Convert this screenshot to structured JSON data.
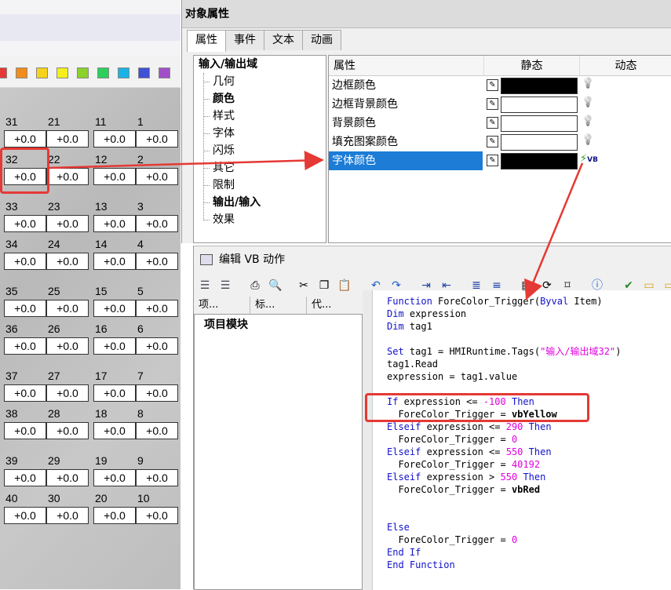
{
  "left_panel": {
    "palette_colors": [
      "#e53935",
      "#f28c1c",
      "#f7d21a",
      "#f5ef1b",
      "#8bd22a",
      "#2bcf5b",
      "#1ab3e6",
      "#3f51d4",
      "#a04fc8"
    ],
    "cells": [
      {
        "row": 0,
        "labels": [
          "31",
          "21",
          "11",
          "1"
        ],
        "values": [
          "+0.0",
          "+0.0",
          "+0.0",
          "+0.0"
        ]
      },
      {
        "row": 1,
        "labels": [
          "32",
          "22",
          "12",
          "2"
        ],
        "values": [
          "+0.0",
          "+0.0",
          "+0.0",
          "+0.0"
        ]
      },
      {
        "row": 2,
        "labels": [
          "33",
          "23",
          "13",
          "3"
        ],
        "values": [
          "+0.0",
          "+0.0",
          "+0.0",
          "+0.0"
        ]
      },
      {
        "row": 3,
        "labels": [
          "34",
          "24",
          "14",
          "4"
        ],
        "values": [
          "+0.0",
          "+0.0",
          "+0.0",
          "+0.0"
        ]
      },
      {
        "row": 4,
        "labels": [
          "35",
          "25",
          "15",
          "5"
        ],
        "values": [
          "+0.0",
          "+0.0",
          "+0.0",
          "+0.0"
        ]
      },
      {
        "row": 5,
        "labels": [
          "36",
          "26",
          "16",
          "6"
        ],
        "values": [
          "+0.0",
          "+0.0",
          "+0.0",
          "+0.0"
        ]
      },
      {
        "row": 6,
        "labels": [
          "37",
          "27",
          "17",
          "7"
        ],
        "values": [
          "+0.0",
          "+0.0",
          "+0.0",
          "+0.0"
        ]
      },
      {
        "row": 7,
        "labels": [
          "38",
          "28",
          "18",
          "8"
        ],
        "values": [
          "+0.0",
          "+0.0",
          "+0.0",
          "+0.0"
        ]
      },
      {
        "row": 8,
        "labels": [
          "39",
          "29",
          "19",
          "9"
        ],
        "values": [
          "+0.0",
          "+0.0",
          "+0.0",
          "+0.0"
        ]
      },
      {
        "row": 9,
        "labels": [
          "40",
          "30",
          "20",
          "10"
        ],
        "values": [
          "+0.0",
          "+0.0",
          "+0.0",
          "+0.0"
        ]
      }
    ]
  },
  "props": {
    "title": "对象属性",
    "tabs": [
      "属性",
      "事件",
      "文本",
      "动画"
    ],
    "tree": {
      "root": "输入/输出域",
      "items": [
        {
          "label": "几何",
          "bold": false
        },
        {
          "label": "颜色",
          "bold": true
        },
        {
          "label": "样式",
          "bold": false
        },
        {
          "label": "字体",
          "bold": false
        },
        {
          "label": "闪烁",
          "bold": false
        },
        {
          "label": "其它",
          "bold": false
        },
        {
          "label": "限制",
          "bold": false
        },
        {
          "label": "输出/输入",
          "bold": true
        },
        {
          "label": "效果",
          "bold": false
        }
      ]
    },
    "grid": {
      "headers": [
        "属性",
        "静态",
        "动态"
      ],
      "rows": [
        {
          "name": "边框颜色",
          "color": "#000000",
          "dynamic": "bulb-icon",
          "selected": false
        },
        {
          "name": "边框背景颜色",
          "color": "#ffffff",
          "dynamic": "bulb-icon",
          "selected": false
        },
        {
          "name": "背景颜色",
          "color": "#ffffff",
          "dynamic": "bulb-icon",
          "selected": false
        },
        {
          "name": "填充图案颜色",
          "color": "#ffffff",
          "dynamic": "bulb-icon",
          "selected": false
        },
        {
          "name": "字体颜色",
          "color": "#000000",
          "dynamic": "vb-script-icon",
          "selected": true
        }
      ],
      "vb_badge": "VB"
    }
  },
  "vb_editor": {
    "title": "编辑 VB 动作",
    "pane_tabs": [
      "项...",
      "标...",
      "代..."
    ],
    "tree_root": "项目模块",
    "code_lines": [
      [
        {
          "t": "Function",
          "c": "kw"
        },
        {
          "t": " ForeColor_Trigger(",
          "c": ""
        },
        {
          "t": "Byval",
          "c": "kw"
        },
        {
          "t": " Item)",
          "c": ""
        }
      ],
      [
        {
          "t": "Dim",
          "c": "kw"
        },
        {
          "t": " expression",
          "c": ""
        }
      ],
      [
        {
          "t": "Dim",
          "c": "kw"
        },
        {
          "t": " tag1",
          "c": ""
        }
      ],
      [],
      [
        {
          "t": "Set",
          "c": "kw"
        },
        {
          "t": " tag1 = HMIRuntime.Tags(",
          "c": ""
        },
        {
          "t": "\"输入/输出域32\"",
          "c": "str"
        },
        {
          "t": ")",
          "c": ""
        }
      ],
      [
        {
          "t": "tag1.Read",
          "c": ""
        }
      ],
      [
        {
          "t": "expression = tag1.value",
          "c": ""
        }
      ],
      [],
      [
        {
          "t": "If",
          "c": "kw"
        },
        {
          "t": " expression <= ",
          "c": ""
        },
        {
          "t": "-100",
          "c": "num"
        },
        {
          "t": " ",
          "c": ""
        },
        {
          "t": "Then",
          "c": "kw"
        }
      ],
      [
        {
          "t": "  ForeColor_Trigger = ",
          "c": ""
        },
        {
          "t": "vbYellow",
          "c": "bld"
        }
      ],
      [
        {
          "t": "Elseif",
          "c": "kw"
        },
        {
          "t": " expression <= ",
          "c": ""
        },
        {
          "t": "290",
          "c": "num"
        },
        {
          "t": " ",
          "c": ""
        },
        {
          "t": "Then",
          "c": "kw"
        }
      ],
      [
        {
          "t": "  ForeColor_Trigger = ",
          "c": ""
        },
        {
          "t": "0",
          "c": "num"
        }
      ],
      [
        {
          "t": "Elseif",
          "c": "kw"
        },
        {
          "t": " expression <= ",
          "c": ""
        },
        {
          "t": "550",
          "c": "num"
        },
        {
          "t": " ",
          "c": ""
        },
        {
          "t": "Then",
          "c": "kw"
        }
      ],
      [
        {
          "t": "  ForeColor_Trigger = ",
          "c": ""
        },
        {
          "t": "40192",
          "c": "num"
        }
      ],
      [
        {
          "t": "Elseif",
          "c": "kw"
        },
        {
          "t": " expression > ",
          "c": ""
        },
        {
          "t": "550",
          "c": "num"
        },
        {
          "t": " ",
          "c": ""
        },
        {
          "t": "Then",
          "c": "kw"
        }
      ],
      [
        {
          "t": "  ForeColor_Trigger = ",
          "c": ""
        },
        {
          "t": "vbRed",
          "c": "bld"
        }
      ],
      [],
      [],
      [
        {
          "t": "Else",
          "c": "kw"
        }
      ],
      [
        {
          "t": "  ForeColor_Trigger = ",
          "c": ""
        },
        {
          "t": "0",
          "c": "num"
        }
      ],
      [
        {
          "t": "End",
          "c": "kw"
        },
        {
          "t": " ",
          "c": ""
        },
        {
          "t": "If",
          "c": "kw"
        }
      ],
      [
        {
          "t": "End",
          "c": "kw"
        },
        {
          "t": " ",
          "c": ""
        },
        {
          "t": "Function",
          "c": "kw"
        }
      ]
    ]
  }
}
